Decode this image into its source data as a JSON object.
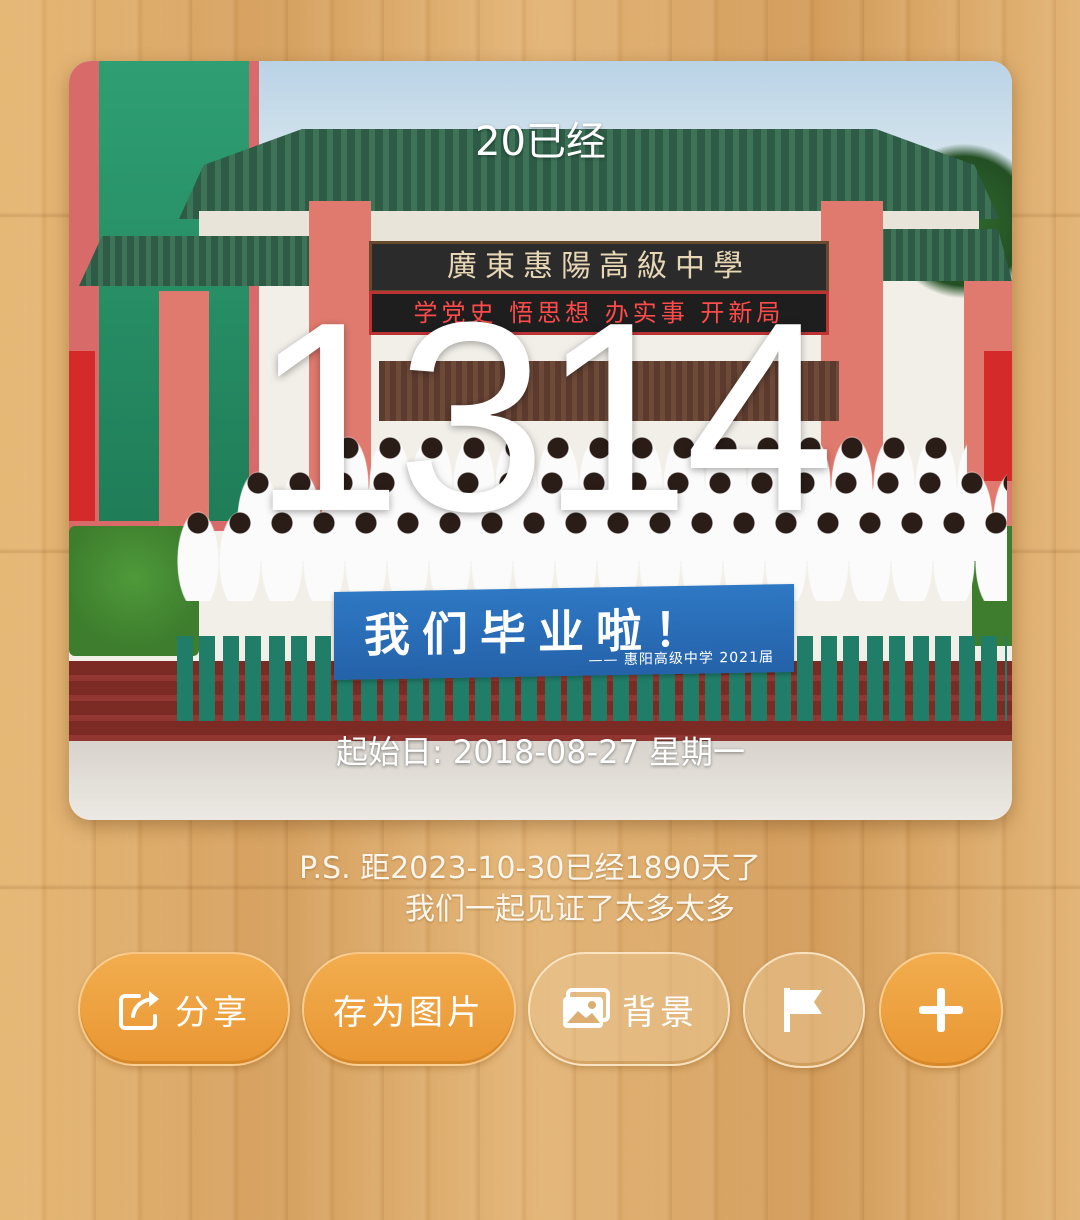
{
  "card": {
    "caption": "20已经",
    "count": "1314",
    "start_date": "起始日: 2018-08-27 星期一",
    "photo": {
      "gate_plaque": "廣東惠陽高級中學",
      "motto": "学党史 悟思想 办实事 开新局",
      "banner_main": "我们毕业啦！",
      "banner_sub": "—— 惠阳高级中学 2021届"
    }
  },
  "note": {
    "line1": "P.S. 距2023-10-30已经1890天了",
    "line2": "我们一起见证了太多太多"
  },
  "actions": {
    "share": "分享",
    "save_image": "存为图片",
    "background": "背景"
  },
  "colors": {
    "button_orange": "#ec9c38",
    "wood": "#d9a663"
  }
}
